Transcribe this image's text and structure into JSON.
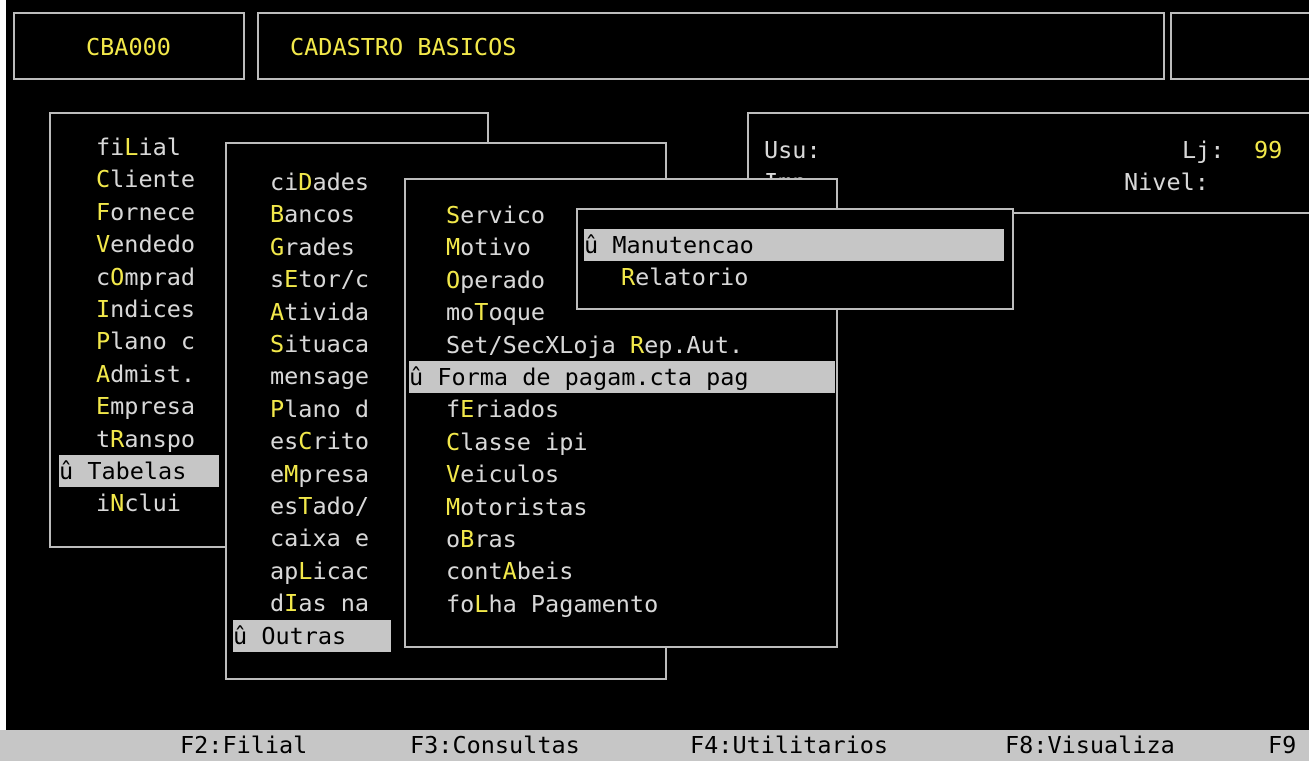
{
  "header": {
    "code": "CBA000",
    "title": "CADASTRO BASICOS"
  },
  "status_panel": {
    "usu_label": "Usu:",
    "lj_label": "Lj:",
    "lj_value": "99",
    "imp_label": "Imp:",
    "nivel_label": "Nivel:"
  },
  "selection_marker": "û",
  "menus": {
    "main": [
      {
        "pre": "fi",
        "hk": "L",
        "post": "ial"
      },
      {
        "pre": "",
        "hk": "C",
        "post": "liente"
      },
      {
        "pre": "",
        "hk": "F",
        "post": "ornece"
      },
      {
        "pre": "",
        "hk": "V",
        "post": "endedo"
      },
      {
        "pre": "c",
        "hk": "O",
        "post": "mprad"
      },
      {
        "pre": "",
        "hk": "I",
        "post": "ndices"
      },
      {
        "pre": "",
        "hk": "P",
        "post": "lano c"
      },
      {
        "pre": "",
        "hk": "A",
        "post": "dmist."
      },
      {
        "pre": "",
        "hk": "E",
        "post": "mpresa"
      },
      {
        "pre": "t",
        "hk": "R",
        "post": "anspo"
      },
      {
        "pre": "",
        "hk": "T",
        "post": "abelas"
      },
      {
        "pre": "i",
        "hk": "N",
        "post": "clui"
      }
    ],
    "tabelas": [
      {
        "pre": "ci",
        "hk": "D",
        "post": "ades"
      },
      {
        "pre": "",
        "hk": "B",
        "post": "ancos"
      },
      {
        "pre": "",
        "hk": "G",
        "post": "rades"
      },
      {
        "pre": "s",
        "hk": "E",
        "post": "tor/c"
      },
      {
        "pre": "",
        "hk": "A",
        "post": "tivida"
      },
      {
        "pre": "",
        "hk": "S",
        "post": "ituaca"
      },
      {
        "pre": "mensage",
        "hk": "",
        "post": ""
      },
      {
        "pre": "",
        "hk": "P",
        "post": "lano d"
      },
      {
        "pre": "es",
        "hk": "C",
        "post": "rito"
      },
      {
        "pre": "e",
        "hk": "M",
        "post": "presa"
      },
      {
        "pre": "es",
        "hk": "T",
        "post": "ado/"
      },
      {
        "pre": "caixa e",
        "hk": "",
        "post": ""
      },
      {
        "pre": "ap",
        "hk": "L",
        "post": "icac"
      },
      {
        "pre": "d",
        "hk": "I",
        "post": "as na"
      },
      {
        "pre": "",
        "hk": "O",
        "post": "utras"
      }
    ],
    "outras": [
      {
        "pre": "",
        "hk": "S",
        "post": "ervico"
      },
      {
        "pre": "",
        "hk": "M",
        "post": "otivo"
      },
      {
        "pre": "",
        "hk": "O",
        "post": "perado"
      },
      {
        "pre": "mo",
        "hk": "T",
        "post": "oque"
      },
      {
        "pre": "Set/SecXLoja ",
        "hk": "R",
        "post": "ep.Aut."
      },
      {
        "pre": "",
        "hk": "F",
        "post": "orma de pagam.cta pag"
      },
      {
        "pre": "f",
        "hk": "E",
        "post": "riados"
      },
      {
        "pre": "",
        "hk": "C",
        "post": "lasse ipi"
      },
      {
        "pre": "",
        "hk": "V",
        "post": "eiculos"
      },
      {
        "pre": "",
        "hk": "M",
        "post": "otoristas"
      },
      {
        "pre": "o",
        "hk": "B",
        "post": "ras"
      },
      {
        "pre": "cont",
        "hk": "A",
        "post": "beis"
      },
      {
        "pre": "fo",
        "hk": "L",
        "post": "ha Pagamento"
      }
    ],
    "forma": [
      {
        "pre": "",
        "hk": "M",
        "post": "anutencao"
      },
      {
        "pre": "",
        "hk": "R",
        "post": "elatorio"
      }
    ]
  },
  "function_keys": [
    "F2:Filial",
    "F3:Consultas",
    "F4:Utilitarios",
    "F8:Visualiza",
    "F9"
  ]
}
